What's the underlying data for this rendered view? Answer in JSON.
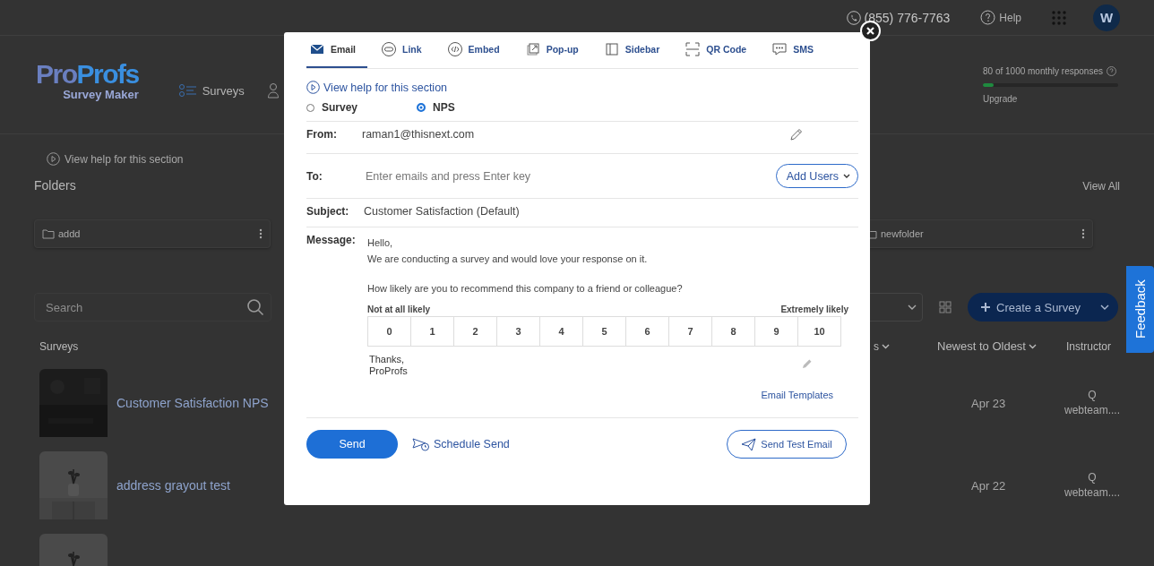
{
  "top_bar": {
    "phone": "(855) 776-7763",
    "help": "Help",
    "avatar": "W"
  },
  "header": {
    "logo_a": "Pro",
    "logo_b": "Profs",
    "logo_sub": "Survey Maker",
    "nav": [
      {
        "label": "Surveys"
      }
    ],
    "usage": {
      "text": "80 of 1000 monthly responses",
      "level": 0.08,
      "link": "Upgrade"
    }
  },
  "help_link": "View help for this section",
  "folders": {
    "title": "Folders",
    "view_all": "View All",
    "items": [
      {
        "name": "addd"
      },
      {
        "name": "newfolder"
      }
    ]
  },
  "search": {
    "placeholder": "Search"
  },
  "create_button": "Create a Survey",
  "table": {
    "columns": [
      "Surveys",
      "s",
      "Newest to Oldest",
      "Instructor"
    ],
    "rows": [
      {
        "thumbnail": {
          "kind": "picture"
        },
        "name": "Customer Satisfaction NPS",
        "date": "Apr 23",
        "instructor": [
          "Q",
          "webteam...."
        ]
      },
      {
        "thumbnail": {
          "kind": "picture"
        },
        "name": "address grayout test",
        "date": "Apr 22",
        "instructor": [
          "Q",
          "webteam...."
        ]
      },
      {
        "thumbnail": {
          "kind": "picture"
        }
      }
    ]
  },
  "feedback_tab": "Feedback",
  "modal": {
    "tabs": [
      {
        "label": "Email",
        "selected": true
      },
      {
        "label": "Link",
        "selected": false
      },
      {
        "label": "Embed",
        "selected": false
      },
      {
        "label": "Pop-up",
        "selected": false
      },
      {
        "label": "Sidebar",
        "selected": false
      },
      {
        "label": "QR Code",
        "selected": false
      },
      {
        "label": "SMS",
        "selected": false
      }
    ],
    "help_link": "View help for this section",
    "types": [
      {
        "label": "Survey",
        "selected": false
      },
      {
        "label": "NPS",
        "selected": true
      }
    ],
    "from": {
      "label": "From:",
      "value": "raman1@thisnext.com"
    },
    "to": {
      "label": "To:",
      "placeholder": "Enter emails and press Enter key",
      "add_users": "Add Users"
    },
    "subject": {
      "label": "Subject:",
      "value": "Customer Satisfaction (Default)"
    },
    "message": {
      "label": "Message:",
      "greeting": "Hello,",
      "intro": "We are conducting a survey and would love your response on it.",
      "question": "How likely are you to recommend this company to a friend or colleague?",
      "low_label": "Not at all likely",
      "high_label": "Extremely likely",
      "scale": [
        "0",
        "1",
        "2",
        "3",
        "4",
        "5",
        "6",
        "7",
        "8",
        "9",
        "10"
      ],
      "signoff": [
        "Thanks,",
        "ProProfs"
      ],
      "templates_link": "Email Templates"
    },
    "send": "Send",
    "schedule": "Schedule Send",
    "test": "Send Test Email"
  }
}
